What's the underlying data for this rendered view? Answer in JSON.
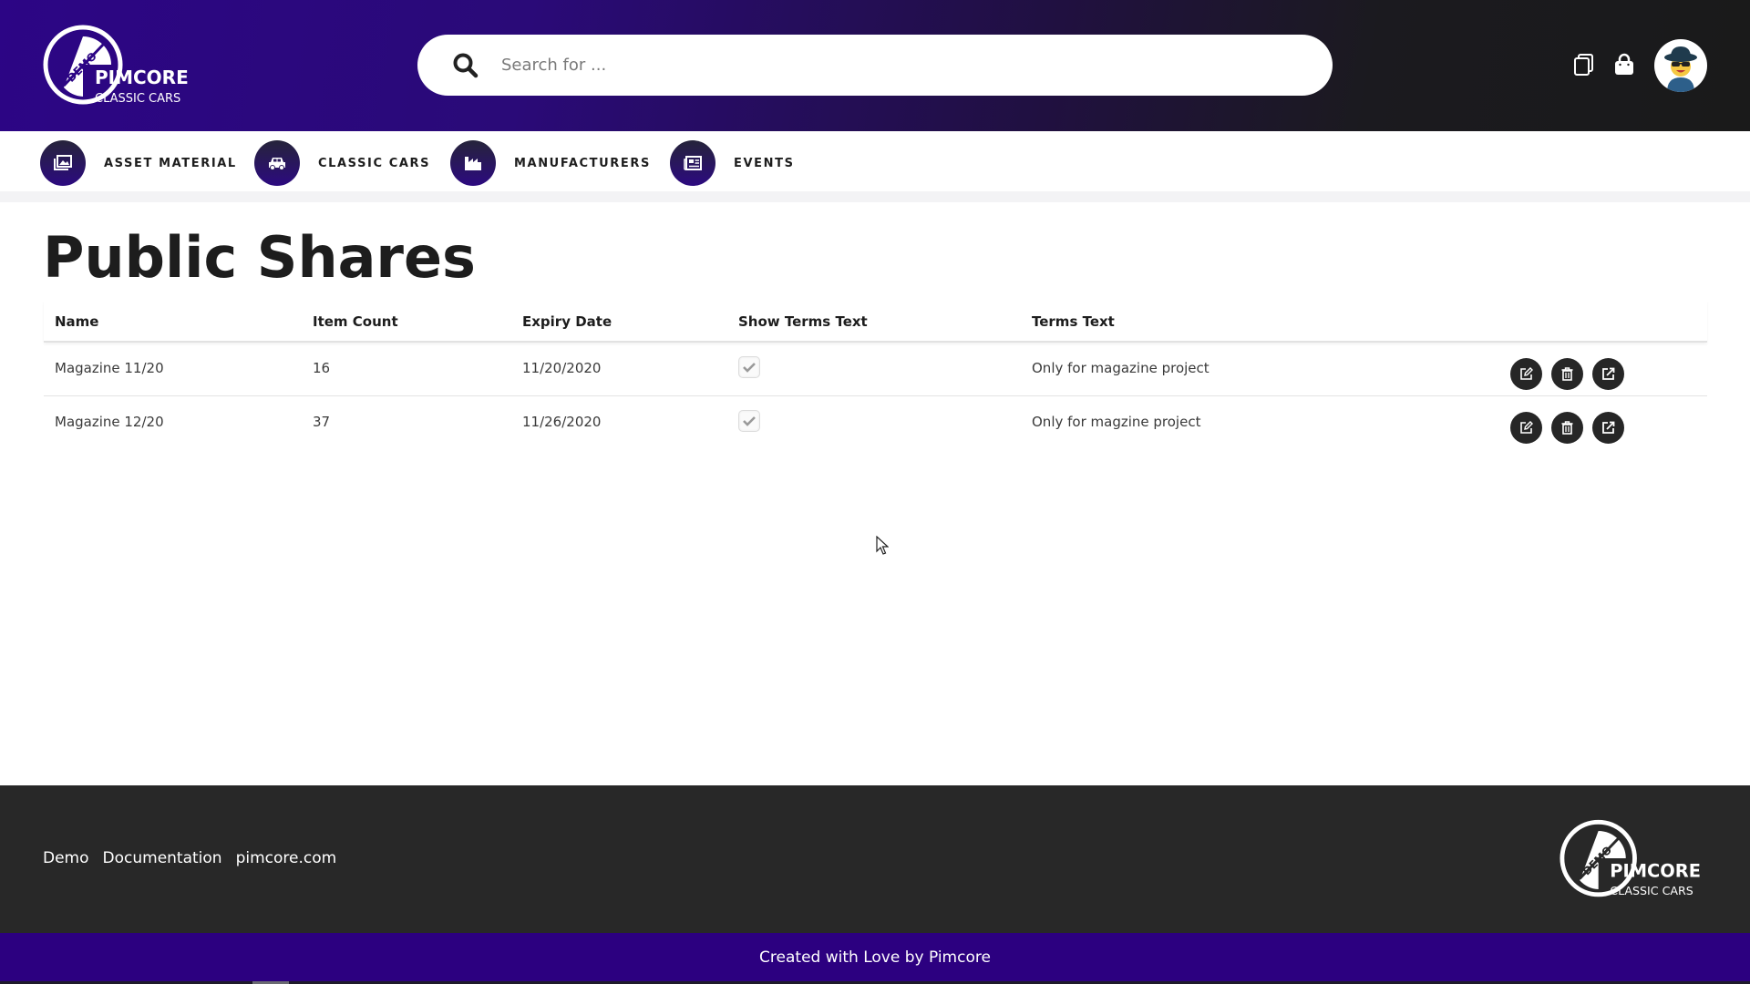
{
  "header": {
    "logo": {
      "badge": "DEMO",
      "brand": "PIMCORE",
      "subtitle": "CLASSIC CARS",
      "icon": "pimcore-demo-logo"
    },
    "search": {
      "placeholder": "Search for ...",
      "value": "",
      "icon": "search-icon"
    },
    "icons": [
      {
        "name": "collections-icon"
      },
      {
        "name": "shopping-bag-icon"
      }
    ],
    "avatar": {
      "name": "user-avatar"
    }
  },
  "nav": {
    "items": [
      {
        "label": "ASSET MATERIAL",
        "icon": "images-icon"
      },
      {
        "label": "CLASSIC CARS",
        "icon": "car-icon"
      },
      {
        "label": "MANUFACTURERS",
        "icon": "industry-icon"
      },
      {
        "label": "EVENTS",
        "icon": "newspaper-icon"
      }
    ]
  },
  "main": {
    "title": "Public Shares",
    "table": {
      "columns": [
        "Name",
        "Item Count",
        "Expiry Date",
        "Show Terms Text",
        "Terms Text"
      ],
      "rows": [
        {
          "name": "Magazine 11/20",
          "item_count": "16",
          "expiry_date": "11/20/2020",
          "show_terms_text": true,
          "terms_text": "Only for magazine project"
        },
        {
          "name": "Magazine 12/20",
          "item_count": "37",
          "expiry_date": "11/26/2020",
          "show_terms_text": true,
          "terms_text": "Only for magzine project"
        }
      ],
      "row_actions": [
        {
          "name": "edit",
          "icon": "edit-icon"
        },
        {
          "name": "delete",
          "icon": "trash-icon"
        },
        {
          "name": "open",
          "icon": "external-link-icon"
        }
      ]
    }
  },
  "footer": {
    "links": [
      "Demo",
      "Documentation",
      "pimcore.com"
    ],
    "logo": {
      "badge": "DEMO",
      "brand": "PIMCORE",
      "subtitle": "CLASSIC CARS"
    },
    "credit": "Created with Love by Pimcore"
  },
  "colors": {
    "brand_purple": "#2c0080",
    "header_dark": "#1a1a1a",
    "footer_bg": "#282828",
    "action_button": "#262626"
  }
}
